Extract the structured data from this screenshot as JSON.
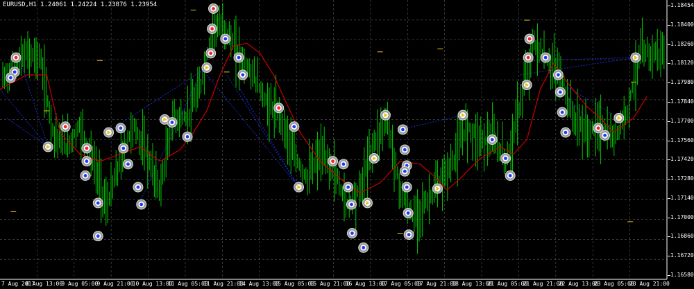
{
  "symbol_info": "EURUSD,H1  1.24061 1.24224 1.23876 1.23954",
  "price_axis": [
    "1.18454",
    "1.18400",
    "1.18260",
    "1.18120",
    "1.17980",
    "1.17840",
    "1.17700",
    "1.17560",
    "1.17420",
    "1.17280",
    "1.17140",
    "1.17000",
    "1.16860",
    "1.16720",
    "1.16580"
  ],
  "time_axis": [
    "7 Aug 2017",
    "8 Aug 13:00",
    "9 Aug 05:00",
    "9 Aug 21:00",
    "10 Aug 13:00",
    "11 Aug 05:00",
    "11 Aug 21:00",
    "14 Aug 13:00",
    "15 Aug 05:00",
    "15 Aug 21:00",
    "16 Aug 13:00",
    "17 Aug 05:00",
    "17 Aug 21:00",
    "18 Aug 13:00",
    "21 Aug 05:00",
    "21 Aug 21:00",
    "22 Aug 13:00",
    "23 Aug 05:00",
    "23 Aug 21:00"
  ],
  "colors": {
    "background": "#000000",
    "grid": "#5a5a5a",
    "candles": "#00cc00",
    "ma_line": "#cc0000",
    "dotted_lines": "#1a2fd6",
    "text": "#ffffff"
  },
  "chart_data": {
    "type": "candlestick",
    "symbol": "EURUSD",
    "timeframe": "H1",
    "ylim": [
      1.1658,
      1.1852
    ],
    "close_path": [
      [
        0,
        1.1795
      ],
      [
        0.02,
        1.1805
      ],
      [
        0.04,
        1.1815
      ],
      [
        0.06,
        1.1812
      ],
      [
        0.08,
        1.176
      ],
      [
        0.1,
        1.175
      ],
      [
        0.12,
        1.1765
      ],
      [
        0.14,
        1.174
      ],
      [
        0.16,
        1.1708
      ],
      [
        0.18,
        1.174
      ],
      [
        0.2,
        1.1765
      ],
      [
        0.22,
        1.1745
      ],
      [
        0.24,
        1.172
      ],
      [
        0.26,
        1.177
      ],
      [
        0.28,
        1.177
      ],
      [
        0.3,
        1.179
      ],
      [
        0.32,
        1.1835
      ],
      [
        0.34,
        1.183
      ],
      [
        0.36,
        1.1812
      ],
      [
        0.38,
        1.18
      ],
      [
        0.4,
        1.178
      ],
      [
        0.42,
        1.1772
      ],
      [
        0.44,
        1.1745
      ],
      [
        0.46,
        1.1728
      ],
      [
        0.48,
        1.1745
      ],
      [
        0.5,
        1.1735
      ],
      [
        0.52,
        1.171
      ],
      [
        0.54,
        1.172
      ],
      [
        0.56,
        1.1752
      ],
      [
        0.58,
        1.177
      ],
      [
        0.6,
        1.172
      ],
      [
        0.62,
        1.17
      ],
      [
        0.64,
        1.1712
      ],
      [
        0.66,
        1.1725
      ],
      [
        0.68,
        1.174
      ],
      [
        0.7,
        1.1765
      ],
      [
        0.72,
        1.1755
      ],
      [
        0.74,
        1.1755
      ],
      [
        0.76,
        1.174
      ],
      [
        0.78,
        1.178
      ],
      [
        0.8,
        1.1822
      ],
      [
        0.82,
        1.181
      ],
      [
        0.84,
        1.18
      ],
      [
        0.86,
        1.177
      ],
      [
        0.88,
        1.176
      ],
      [
        0.9,
        1.1765
      ],
      [
        0.92,
        1.1755
      ],
      [
        0.94,
        1.1775
      ],
      [
        0.96,
        1.1815
      ]
    ],
    "ma_path": [
      [
        0,
        1.179
      ],
      [
        0.04,
        1.18
      ],
      [
        0.07,
        1.18
      ],
      [
        0.09,
        1.176
      ],
      [
        0.12,
        1.1745
      ],
      [
        0.15,
        1.174
      ],
      [
        0.18,
        1.1745
      ],
      [
        0.21,
        1.175
      ],
      [
        0.24,
        1.174
      ],
      [
        0.27,
        1.1748
      ],
      [
        0.29,
        1.176
      ],
      [
        0.31,
        1.1775
      ],
      [
        0.33,
        1.18
      ],
      [
        0.35,
        1.182
      ],
      [
        0.37,
        1.1822
      ],
      [
        0.39,
        1.1815
      ],
      [
        0.41,
        1.18
      ],
      [
        0.43,
        1.178
      ],
      [
        0.45,
        1.176
      ],
      [
        0.48,
        1.174
      ],
      [
        0.51,
        1.1728
      ],
      [
        0.54,
        1.1718
      ],
      [
        0.57,
        1.1725
      ],
      [
        0.6,
        1.174
      ],
      [
        0.63,
        1.1738
      ],
      [
        0.65,
        1.173
      ],
      [
        0.67,
        1.172
      ],
      [
        0.69,
        1.1728
      ],
      [
        0.72,
        1.1742
      ],
      [
        0.75,
        1.175
      ],
      [
        0.77,
        1.1745
      ],
      [
        0.79,
        1.1755
      ],
      [
        0.81,
        1.179
      ],
      [
        0.83,
        1.1808
      ],
      [
        0.85,
        1.1795
      ],
      [
        0.88,
        1.1778
      ],
      [
        0.9,
        1.177
      ],
      [
        0.92,
        1.176
      ],
      [
        0.95,
        1.177
      ],
      [
        0.97,
        1.1785
      ]
    ],
    "markers": [
      {
        "x": 0.022,
        "y": 1.1802,
        "kind": "up"
      },
      {
        "x": 0.016,
        "y": 1.1798,
        "kind": "up"
      },
      {
        "x": 0.024,
        "y": 1.1812,
        "kind": "dn"
      },
      {
        "x": 0.072,
        "y": 1.175,
        "kind": "flag"
      },
      {
        "x": 0.098,
        "y": 1.1764,
        "kind": "dn"
      },
      {
        "x": 0.13,
        "y": 1.1749,
        "kind": "dn"
      },
      {
        "x": 0.13,
        "y": 1.174,
        "kind": "up"
      },
      {
        "x": 0.128,
        "y": 1.173,
        "kind": "up"
      },
      {
        "x": 0.147,
        "y": 1.1711,
        "kind": "up"
      },
      {
        "x": 0.147,
        "y": 1.1688,
        "kind": "up"
      },
      {
        "x": 0.163,
        "y": 1.176,
        "kind": "flag"
      },
      {
        "x": 0.181,
        "y": 1.1763,
        "kind": "up"
      },
      {
        "x": 0.185,
        "y": 1.1749,
        "kind": "up"
      },
      {
        "x": 0.192,
        "y": 1.1738,
        "kind": "up"
      },
      {
        "x": 0.207,
        "y": 1.1722,
        "kind": "up"
      },
      {
        "x": 0.212,
        "y": 1.171,
        "kind": "up"
      },
      {
        "x": 0.247,
        "y": 1.1769,
        "kind": "flag"
      },
      {
        "x": 0.258,
        "y": 1.1767,
        "kind": "up"
      },
      {
        "x": 0.281,
        "y": 1.1757,
        "kind": "up"
      },
      {
        "x": 0.31,
        "y": 1.1805,
        "kind": "flag"
      },
      {
        "x": 0.316,
        "y": 1.1815,
        "kind": "dn"
      },
      {
        "x": 0.318,
        "y": 1.1832,
        "kind": "dn"
      },
      {
        "x": 0.32,
        "y": 1.1846,
        "kind": "dn"
      },
      {
        "x": 0.338,
        "y": 1.1825,
        "kind": "up"
      },
      {
        "x": 0.358,
        "y": 1.1812,
        "kind": "up"
      },
      {
        "x": 0.364,
        "y": 1.18,
        "kind": "up"
      },
      {
        "x": 0.418,
        "y": 1.1777,
        "kind": "dn"
      },
      {
        "x": 0.441,
        "y": 1.1764,
        "kind": "up"
      },
      {
        "x": 0.448,
        "y": 1.1722,
        "kind": "flag"
      },
      {
        "x": 0.499,
        "y": 1.174,
        "kind": "dn"
      },
      {
        "x": 0.515,
        "y": 1.1738,
        "kind": "up"
      },
      {
        "x": 0.522,
        "y": 1.1722,
        "kind": "up"
      },
      {
        "x": 0.527,
        "y": 1.171,
        "kind": "up"
      },
      {
        "x": 0.528,
        "y": 1.169,
        "kind": "up"
      },
      {
        "x": 0.545,
        "y": 1.168,
        "kind": "up"
      },
      {
        "x": 0.551,
        "y": 1.1711,
        "kind": "flag"
      },
      {
        "x": 0.561,
        "y": 1.1742,
        "kind": "flag"
      },
      {
        "x": 0.578,
        "y": 1.1772,
        "kind": "flag"
      },
      {
        "x": 0.604,
        "y": 1.1762,
        "kind": "up"
      },
      {
        "x": 0.607,
        "y": 1.1748,
        "kind": "up"
      },
      {
        "x": 0.61,
        "y": 1.1737,
        "kind": "up"
      },
      {
        "x": 0.607,
        "y": 1.1733,
        "kind": "up"
      },
      {
        "x": 0.61,
        "y": 1.1722,
        "kind": "up"
      },
      {
        "x": 0.612,
        "y": 1.1704,
        "kind": "up"
      },
      {
        "x": 0.613,
        "y": 1.1689,
        "kind": "up"
      },
      {
        "x": 0.656,
        "y": 1.1721,
        "kind": "flag"
      },
      {
        "x": 0.694,
        "y": 1.1772,
        "kind": "flag"
      },
      {
        "x": 0.738,
        "y": 1.1755,
        "kind": "up"
      },
      {
        "x": 0.758,
        "y": 1.1742,
        "kind": "up"
      },
      {
        "x": 0.765,
        "y": 1.173,
        "kind": "up"
      },
      {
        "x": 0.79,
        "y": 1.1793,
        "kind": "flag"
      },
      {
        "x": 0.792,
        "y": 1.1812,
        "kind": "dn"
      },
      {
        "x": 0.794,
        "y": 1.1825,
        "kind": "dn"
      },
      {
        "x": 0.818,
        "y": 1.1812,
        "kind": "up"
      },
      {
        "x": 0.837,
        "y": 1.18,
        "kind": "up"
      },
      {
        "x": 0.84,
        "y": 1.1788,
        "kind": "up"
      },
      {
        "x": 0.843,
        "y": 1.1774,
        "kind": "up"
      },
      {
        "x": 0.848,
        "y": 1.176,
        "kind": "up"
      },
      {
        "x": 0.897,
        "y": 1.1763,
        "kind": "dn"
      },
      {
        "x": 0.907,
        "y": 1.1758,
        "kind": "up"
      },
      {
        "x": 0.928,
        "y": 1.177,
        "kind": "flag"
      },
      {
        "x": 0.953,
        "y": 1.1812,
        "kind": "flag"
      }
    ],
    "dotted_fans": [
      {
        "from": [
          0.0,
          1.179
        ],
        "to": [
          0.072,
          1.175
        ]
      },
      {
        "from": [
          0.01,
          1.177
        ],
        "to": [
          0.072,
          1.175
        ]
      },
      {
        "from": [
          0.03,
          1.181
        ],
        "to": [
          0.072,
          1.175
        ]
      },
      {
        "from": [
          0.31,
          1.18
        ],
        "to": [
          0.448,
          1.1722
        ]
      },
      {
        "from": [
          0.34,
          1.18
        ],
        "to": [
          0.448,
          1.1722
        ]
      },
      {
        "from": [
          0.36,
          1.179
        ],
        "to": [
          0.448,
          1.1722
        ]
      },
      {
        "from": [
          0.16,
          1.176
        ],
        "to": [
          0.31,
          1.1805
        ]
      },
      {
        "from": [
          0.21,
          1.1712
        ],
        "to": [
          0.31,
          1.181
        ]
      },
      {
        "from": [
          0.6,
          1.1762
        ],
        "to": [
          0.694,
          1.1772
        ]
      },
      {
        "from": [
          0.78,
          1.18
        ],
        "to": [
          0.953,
          1.1812
        ]
      },
      {
        "from": [
          0.8,
          1.181
        ],
        "to": [
          0.953,
          1.1812
        ]
      },
      {
        "from": [
          0.82,
          1.18
        ],
        "to": [
          0.928,
          1.177
        ]
      },
      {
        "from": [
          0.84,
          1.179
        ],
        "to": [
          0.9,
          1.176
        ]
      }
    ]
  }
}
